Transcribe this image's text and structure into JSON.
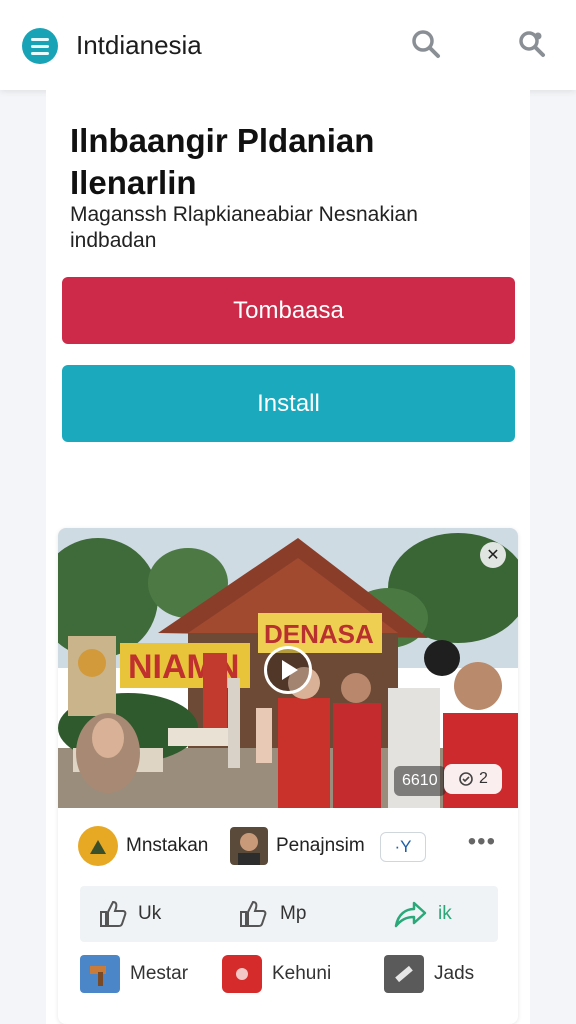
{
  "header": {
    "app_title": "Intdianesia",
    "menu_icon": "menu-icon",
    "search_icon": "search-icon",
    "search_alt_icon": "search-icon"
  },
  "hero": {
    "headline": "Ilnbaangir Pldanian Ilenarlin",
    "subline": "Maganssh Rlapkianeabiar Nesnakian indbadan"
  },
  "buttons": {
    "primary_label": "Tombaasa",
    "install_label": "Install"
  },
  "card": {
    "media": {
      "banner_left": "NIAMN",
      "banner_right": "DENASA",
      "view_count": "6610",
      "rating_count": "2",
      "close_icon": "close-icon",
      "play_icon": "play-icon"
    },
    "info_row": {
      "user1_name": "Mnstakan",
      "user2_name": "Penajnsim",
      "chip_label": "·Y",
      "more_icon": "more-icon"
    },
    "actions": {
      "like_label": "Uk",
      "like2_label": "Mp",
      "share_label": "ik"
    },
    "bottom_row": {
      "item1_label": "Mestar",
      "item2_label": "Kehuni",
      "item3_label": "Jads"
    }
  },
  "colors": {
    "primary_red": "#cc2a48",
    "teal": "#1ba9bd",
    "share_green": "#2aa87a"
  }
}
